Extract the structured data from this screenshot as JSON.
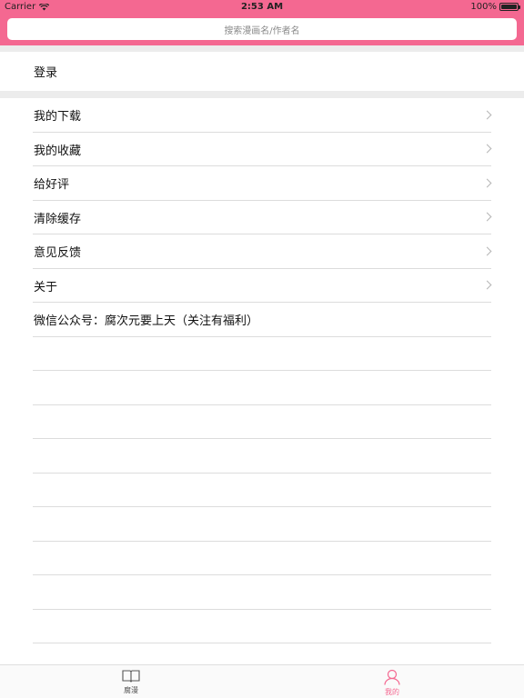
{
  "status_bar": {
    "carrier": "Carrier",
    "time": "2:53 AM",
    "battery": "100%"
  },
  "search": {
    "placeholder": "搜索漫画名/作者名"
  },
  "login": {
    "label": "登录"
  },
  "menu": {
    "items": [
      {
        "label": "我的下载"
      },
      {
        "label": "我的收藏"
      },
      {
        "label": "给好评"
      },
      {
        "label": "清除缓存"
      },
      {
        "label": "意见反馈"
      },
      {
        "label": "关于"
      }
    ],
    "wechat": "微信公众号：腐次元要上天（关注有福利）"
  },
  "tabbar": {
    "tabs": [
      {
        "label": "腐漫",
        "icon": "book-icon",
        "active": false
      },
      {
        "label": "我的",
        "icon": "person-icon",
        "active": true
      }
    ]
  },
  "colors": {
    "accent": "#f46891",
    "separator": "#dcdcdc",
    "band": "#ececec"
  }
}
